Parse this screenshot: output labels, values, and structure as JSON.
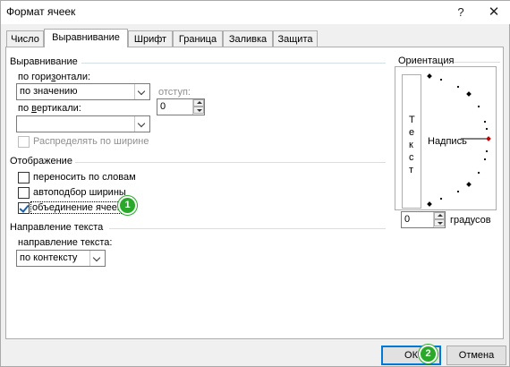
{
  "window": {
    "title": "Формат ячеек",
    "help_glyph": "?",
    "close_glyph": "✕"
  },
  "tabs": [
    {
      "label": "Число"
    },
    {
      "label": "Выравнивание",
      "active": true
    },
    {
      "label": "Шрифт"
    },
    {
      "label": "Граница"
    },
    {
      "label": "Заливка"
    },
    {
      "label": "Защита"
    }
  ],
  "alignment": {
    "section_title": "Выравнивание",
    "horizontal_label_pre": "по гори",
    "horizontal_label_ul": "з",
    "horizontal_label_post": "онтали:",
    "horizontal_value": "по значению",
    "indent_label": "отступ:",
    "indent_value": "0",
    "vertical_label_pre": "по ",
    "vertical_label_ul": "в",
    "vertical_label_post": "ертикали:",
    "vertical_value": "",
    "distribute_label": "Распределять по ширине",
    "distribute_checked": false,
    "distribute_enabled": false
  },
  "display": {
    "section_title": "Отображение",
    "wrap_label": "переносить по словам",
    "wrap_checked": false,
    "autofit_label": "автоподбор ширины",
    "autofit_checked": false,
    "merge_label": "объединение ячеек",
    "merge_checked": true,
    "merge_badge": "1"
  },
  "direction": {
    "section_title": "Направление текста",
    "label": "направление текста:",
    "value": "по контексту"
  },
  "orientation": {
    "section_title": "Ориентация",
    "vertical_text_letters": [
      "Т",
      "е",
      "к",
      "с",
      "т"
    ],
    "dial_label": "Надпись",
    "degrees_value": "0",
    "degrees_label": "градусов",
    "marker_color": "#c00000"
  },
  "footer": {
    "ok_label": "ОК",
    "ok_badge": "2",
    "cancel_label": "Отмена"
  },
  "colors": {
    "badge": "#2aa82a",
    "focus_border": "#0078d7"
  }
}
